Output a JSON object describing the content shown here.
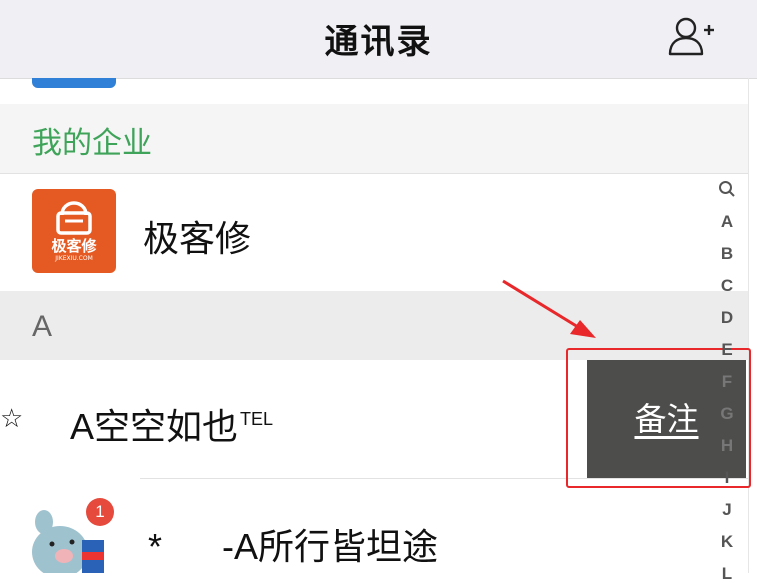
{
  "header": {
    "title": "通讯录",
    "add_contact_icon": "add-contact-icon"
  },
  "sections": {
    "enterprise": {
      "label": "我的企业",
      "item": {
        "name": "极客修",
        "logo_text": "极客修",
        "logo_subtext": "JIKEXIU.COM"
      }
    },
    "a": {
      "label": "A"
    }
  },
  "contacts": [
    {
      "edge_glyph": "☆",
      "name": "A空空如也",
      "suffix": "TEL"
    },
    {
      "name": "*      -A所行皆坦途",
      "badge": "1"
    }
  ],
  "swipe_action": {
    "label": "备注"
  },
  "index_bar": {
    "search_icon": "search-icon",
    "letters": [
      "A",
      "B",
      "C",
      "D",
      "E",
      "F",
      "G",
      "H",
      "I",
      "J",
      "K",
      "L"
    ]
  },
  "colors": {
    "section_green": "#3fa45a",
    "logo_orange": "#e55a23",
    "action_gray": "#4d4d4b",
    "highlight_red": "#e8282a"
  }
}
